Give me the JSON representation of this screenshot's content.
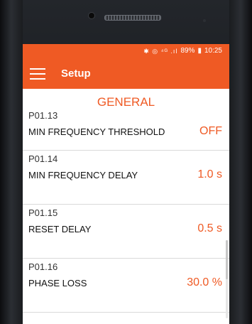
{
  "statusbar": {
    "icons": "✱ ◎ ⁴ᴳ .ıl",
    "battery": "89%",
    "time": "10:25"
  },
  "appbar": {
    "title": "Setup",
    "menu_icon": "hamburger-menu-icon"
  },
  "section": {
    "title": "GENERAL"
  },
  "params": [
    {
      "code": "P01.13",
      "name": "MIN FREQUENCY THRESHOLD",
      "value": "OFF"
    },
    {
      "code": "P01.14",
      "name": "MIN FREQUENCY DELAY",
      "value": "1.0 s"
    },
    {
      "code": "P01.15",
      "name": "RESET DELAY",
      "value": "0.5 s"
    },
    {
      "code": "P01.16",
      "name": "PHASE LOSS",
      "value": "30.0 %"
    }
  ],
  "colors": {
    "accent": "#ef5a24"
  }
}
